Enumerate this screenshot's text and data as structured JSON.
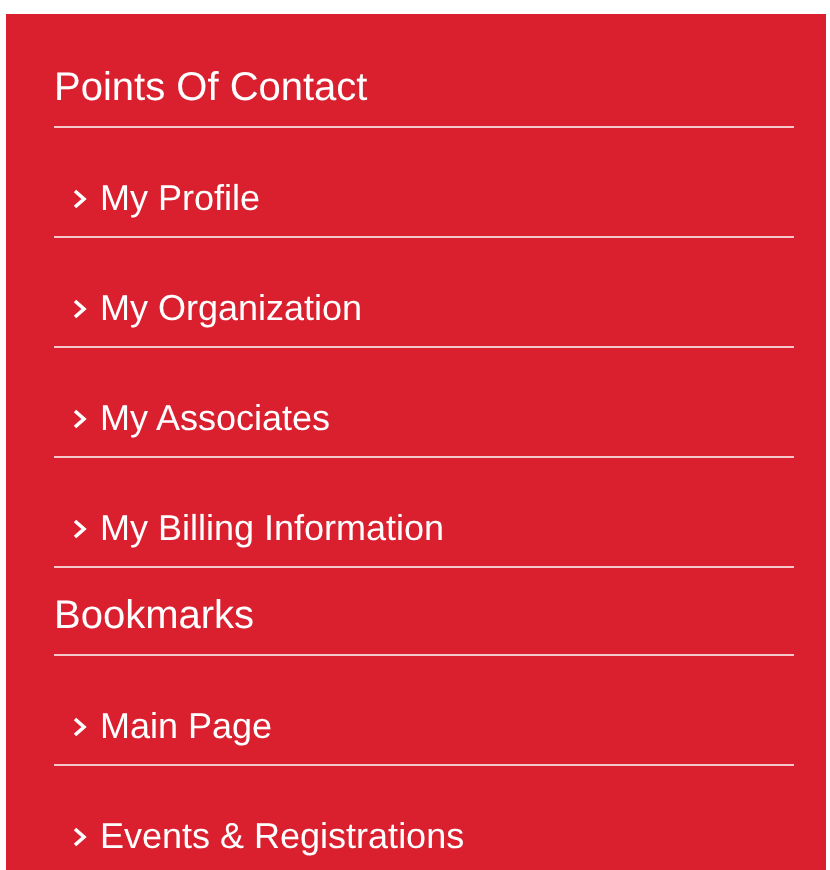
{
  "sections": [
    {
      "title": "Points Of Contact",
      "links": [
        {
          "label": "My Profile"
        },
        {
          "label": "My Organization"
        },
        {
          "label": "My Associates"
        },
        {
          "label": "My Billing Information"
        }
      ]
    },
    {
      "title": "Bookmarks",
      "links": [
        {
          "label": "Main Page"
        },
        {
          "label": "Events & Registrations"
        }
      ]
    }
  ]
}
